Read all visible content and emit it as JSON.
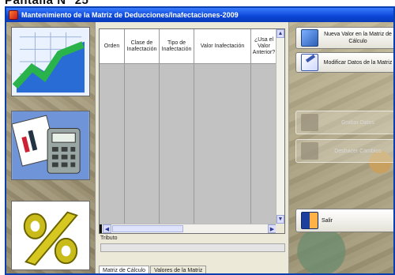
{
  "page_heading": "Pantalla N° 25",
  "window": {
    "title": "Mantenimiento de la Matriz de Deducciones/Inafectaciones-2009"
  },
  "grid": {
    "columns": [
      "Orden",
      "Clase de Inafectación",
      "Tipo de Inafectación",
      "Valor Inafectación",
      "¿Usa el Valor Anterior?"
    ]
  },
  "tributo": {
    "label": "Tributo",
    "value": ""
  },
  "tabs": [
    "Matriz de Cálculo",
    "Valores de la Matriz"
  ],
  "buttons": {
    "nuevo_valor": "Nueva Valor en la Matriz de Cálculo",
    "modificar": "Modificar Datos de la Matriz",
    "grabar": "Grabar Datos",
    "deshacer": "Deshacer Cambios",
    "salir": "Salir"
  },
  "icons": {
    "app": "app-icon",
    "tile1": "chart-icon",
    "tile2": "calculator-icon",
    "tile3": "percent-icon"
  },
  "colors": {
    "titlebar": "#0b45d6",
    "panel": "#ece9d8",
    "grid_body": "#c2c2c2"
  }
}
